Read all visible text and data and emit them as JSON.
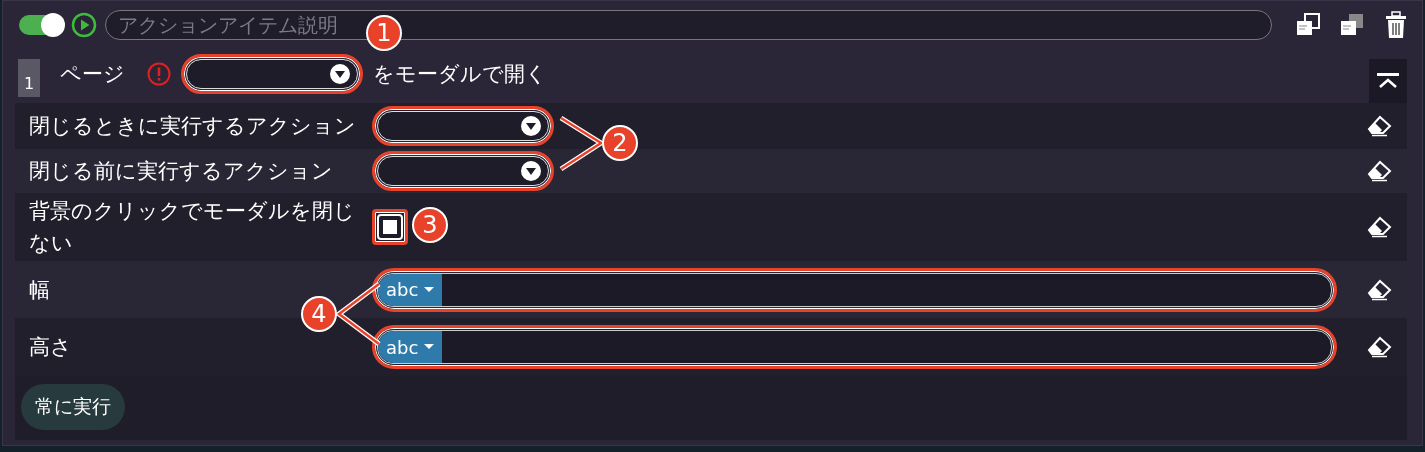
{
  "header": {
    "enabled": true,
    "description": {
      "placeholder": "アクションアイテム説明"
    }
  },
  "step": {
    "number": "1",
    "label": "ページ",
    "warning": true,
    "select": {
      "highlighted": true
    },
    "suffix": "をモーダルで開く"
  },
  "rows": [
    {
      "kind": "select",
      "label": "閉じるときに実行するアクション",
      "highlighted": true
    },
    {
      "kind": "select",
      "label": "閉じる前に実行するアクション",
      "highlighted": true
    },
    {
      "kind": "checkbox",
      "label": "背景のクリックでモーダルを閉じない",
      "checked": false,
      "highlighted": true
    },
    {
      "kind": "text",
      "label": "幅",
      "type_label": "abc",
      "highlighted": true
    },
    {
      "kind": "text",
      "label": "高さ",
      "type_label": "abc",
      "highlighted": true
    }
  ],
  "footer": {
    "button": "常に実行"
  },
  "annotations": [
    {
      "label": "1"
    },
    {
      "label": "2"
    },
    {
      "label": "3"
    },
    {
      "label": "4"
    }
  ]
}
